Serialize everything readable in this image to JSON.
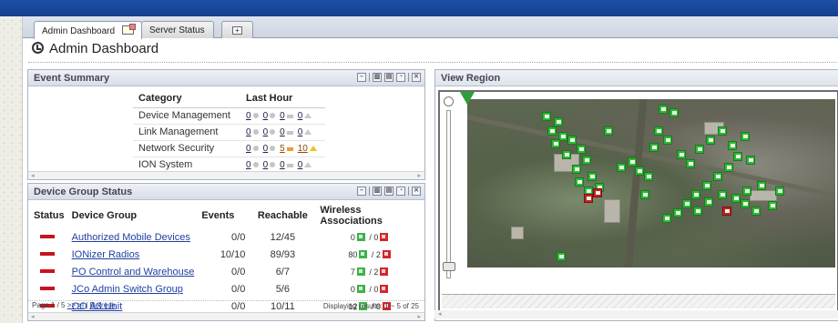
{
  "tabs": [
    {
      "label": "Admin Dashboard",
      "active": true,
      "icon": "edit-icon"
    },
    {
      "label": "Server Status",
      "active": false
    },
    {
      "label": "",
      "icon": "add-tab-icon"
    }
  ],
  "page": {
    "title": "Admin Dashboard",
    "icon": "dashboard-icon"
  },
  "event_summary": {
    "title": "Event Summary",
    "headers": {
      "category": "Category",
      "last_hour": "Last Hour"
    },
    "rows": [
      {
        "category": "Device Management",
        "counts": [
          "0",
          "0",
          "0",
          "0"
        ],
        "highlight": [
          false,
          false,
          false,
          false
        ]
      },
      {
        "category": "Link Management",
        "counts": [
          "0",
          "0",
          "0",
          "0"
        ],
        "highlight": [
          false,
          false,
          false,
          false
        ]
      },
      {
        "category": "Network Security",
        "counts": [
          "0",
          "0",
          "5",
          "10"
        ],
        "highlight": [
          false,
          false,
          true,
          true
        ]
      },
      {
        "category": "ION System",
        "counts": [
          "0",
          "0",
          "0",
          "0"
        ],
        "highlight": [
          false,
          false,
          false,
          false
        ]
      }
    ]
  },
  "device_group": {
    "title": "Device Group Status",
    "headers": {
      "status": "Status",
      "group": "Device Group",
      "events": "Events",
      "reachable": "Reachable",
      "wireless": "Wireless Associations"
    },
    "rows": [
      {
        "group": "Authorized Mobile Devices",
        "events": "0/0",
        "reachable": "12/45",
        "wireless_up": "0",
        "wireless_down": "0"
      },
      {
        "group": "IONizer Radios",
        "events": "10/10",
        "reachable": "89/93",
        "wireless_up": "80",
        "wireless_down": "2"
      },
      {
        "group": "PO Control and Warehouse",
        "events": "0/0",
        "reachable": "6/7",
        "wireless_up": "7",
        "wireless_down": "2"
      },
      {
        "group": "JCo Admin Switch Group",
        "events": "0/0",
        "reachable": "5/6",
        "wireless_up": "0",
        "wireless_down": "0"
      },
      {
        "group": "OO A3 Unit",
        "events": "0/0",
        "reachable": "10/11",
        "wireless_up": "12",
        "wireless_down": "0"
      }
    ],
    "pager": {
      "page_label": "Page 1 / 5",
      "next": ">>",
      "last": ">|",
      "refresh": "Refresh",
      "results": "Displaying results: 1 ~ 5 of 25"
    }
  },
  "view_region": {
    "title": "View Region"
  },
  "colors": {
    "header_bar": "#1d4fa7",
    "status_down": "#c8141b",
    "marker_ok": "#2cb833",
    "marker_alert": "#c71f23"
  }
}
